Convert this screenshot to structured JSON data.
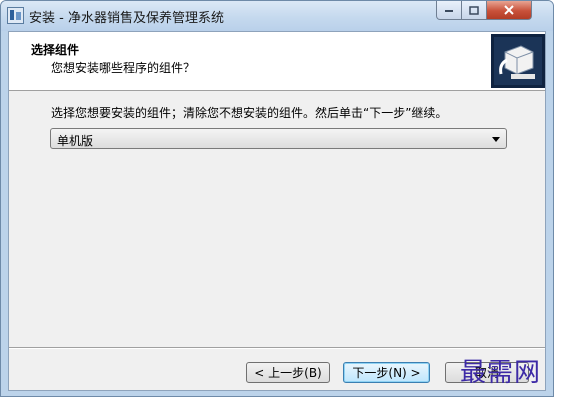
{
  "window": {
    "title": "安装 - 净水器销售及保养管理系统",
    "app_icon": "installer-icon",
    "controls": {
      "minimize": "minimize-icon",
      "maximize": "maximize-icon",
      "close": "close-icon"
    }
  },
  "header": {
    "title": "选择组件",
    "subtitle": "您想安装哪些程序的组件？",
    "logo": "setup-logo-icon"
  },
  "main": {
    "instruction": "选择您想要安装的组件；清除您不想安装的组件。然后单击“下一步”继续。",
    "component_select": {
      "selected": "单机版"
    }
  },
  "buttons": {
    "back": "< 上一步(B)",
    "next": "下一步(N) >",
    "cancel": "取消"
  },
  "watermark": "最需网",
  "colors": {
    "client_bg": "#f0f0f0",
    "header_bg": "#ffffff",
    "titlebar": "#c5d9ee",
    "close": "#c8513a",
    "watermark": "#3d2aa6"
  }
}
